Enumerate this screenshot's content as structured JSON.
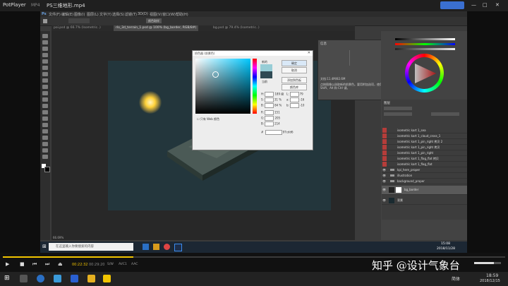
{
  "player": {
    "app_name": "PotPlayer",
    "format": "MP4",
    "file_title": "PS三维地形.mp4",
    "time_current": "00:22:32",
    "time_total": "00:29:20",
    "badges": [
      "S/W",
      "AVC1",
      "AAC"
    ],
    "progress_fraction": 0.26
  },
  "ps": {
    "menu": [
      "文件(F)",
      "编辑(E)",
      "图像(I)",
      "图层(L)",
      "文字(Y)",
      "选择(S)",
      "滤镜(T)",
      "3D(D)",
      "视图(V)",
      "窗口(W)",
      "帮助(H)"
    ],
    "options_label": "颜色取样",
    "tabs": [
      {
        "label": "poi.psd @ 66.7% (Isometric..)"
      },
      {
        "label": "rlo_3d_terrain_1.psd @ 100% (bg_border, RGB/8#)"
      },
      {
        "label": "bg.psd @ 79.4% (Isometric..)"
      }
    ],
    "zoom": "66.69%",
    "color_picker": {
      "title": "拾色器 (前景色)",
      "new_label": "新的",
      "current_label": "当前",
      "ok": "确定",
      "cancel": "取消",
      "add_swatch": "添加到色板",
      "libraries": "颜色库",
      "web_only": "只有 Web 颜色",
      "fields": [
        {
          "k": "H:",
          "v": "189",
          "u": "度"
        },
        {
          "k": "S:",
          "v": "31",
          "u": "%"
        },
        {
          "k": "B:",
          "v": "84",
          "u": "%"
        },
        {
          "k": "R:",
          "v": "151",
          "u": ""
        },
        {
          "k": "G:",
          "v": "205",
          "u": ""
        },
        {
          "k": "B:",
          "v": "214",
          "u": ""
        },
        {
          "k": "L:",
          "v": "79",
          "u": ""
        },
        {
          "k": "a:",
          "v": "-16",
          "u": ""
        },
        {
          "k": "b:",
          "v": "-10",
          "u": ""
        }
      ],
      "hex": "97cdd6",
      "new_color": "#97cdd6",
      "current_color": "#2f4a54"
    },
    "info_panel": {
      "title": "信息",
      "doc_line": "文档:11.4M/82.6M",
      "hint": "点按图像以选取新的前景色。要用附加选项，使用 Shift、Alt 和 Ctrl 键。"
    },
    "layers_title": "图层",
    "layers": [
      {
        "name": "isometric kart 1_sea",
        "red": true
      },
      {
        "name": "isometric kart 1_cloud_cross_1",
        "red": true
      },
      {
        "name": "isometric kart 1_pin_right 拷贝 2",
        "red": true
      },
      {
        "name": "isometric kart 1_pin_right 拷贝",
        "red": true
      },
      {
        "name": "isometric kart 1_pin_right",
        "red": true
      },
      {
        "name": "isometric kart 1_flag_flat 拷贝",
        "red": true
      },
      {
        "name": "isometric kart 1_flag_flat",
        "red": true
      },
      {
        "name": "kpi_here_proper",
        "red": false,
        "folder": true
      },
      {
        "name": "illustration",
        "red": false,
        "folder": true
      },
      {
        "name": "background_proper",
        "red": false,
        "folder": true
      },
      {
        "name": "bg_border",
        "red": false,
        "selected": true
      },
      {
        "name": "背景",
        "red": false
      }
    ],
    "taskbar": {
      "search": "在这里输入你要搜索的内容",
      "time": "15:08",
      "date": "2018/11/28"
    }
  },
  "host": {
    "time": "18:59",
    "date": "2018/12/15",
    "ime": "简体",
    "watermark": "知乎 @设计气象台"
  }
}
